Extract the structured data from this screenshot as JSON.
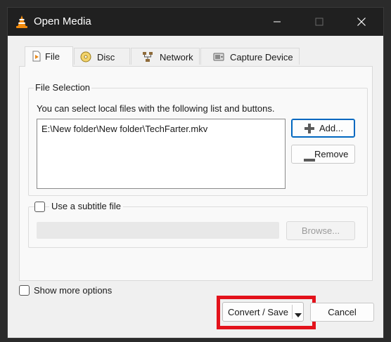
{
  "window": {
    "title": "Open Media"
  },
  "tabs": [
    {
      "label": "File",
      "icon": "file-play-icon",
      "active": true
    },
    {
      "label": "Disc",
      "icon": "disc-icon",
      "active": false
    },
    {
      "label": "Network",
      "icon": "network-icon",
      "active": false
    },
    {
      "label": "Capture Device",
      "icon": "capture-device-icon",
      "active": false
    }
  ],
  "file_selection": {
    "title": "File Selection",
    "hint": "You can select local files with the following list and buttons.",
    "files": [
      "E:\\New folder\\New folder\\TechFarter.mkv"
    ],
    "add_label": "Add...",
    "remove_label": "Remove"
  },
  "subtitle": {
    "label": "Use a subtitle file",
    "checked": false,
    "path_value": "",
    "browse_label": "Browse..."
  },
  "options": {
    "show_more_label": "Show more options",
    "checked": false
  },
  "actions": {
    "convert_label": "Convert / Save",
    "cancel_label": "Cancel"
  },
  "colors": {
    "highlight": "#e3121b",
    "titlebar": "#202020",
    "focus": "#0067c0"
  }
}
